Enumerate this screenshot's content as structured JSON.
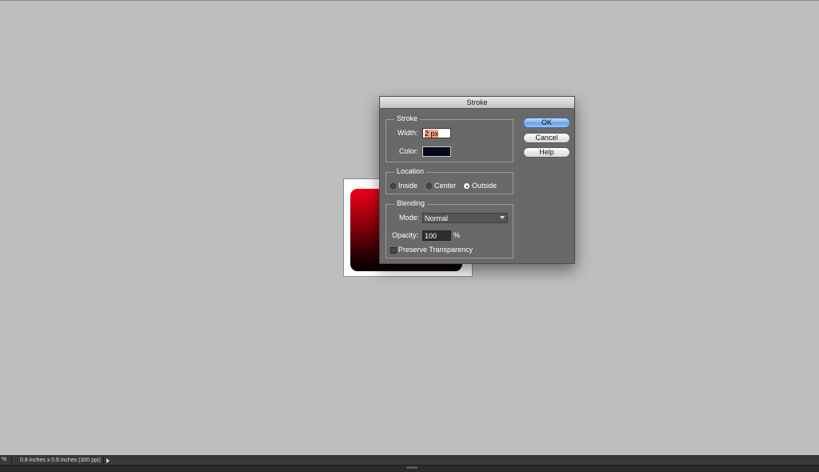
{
  "dialog": {
    "title": "Stroke",
    "stroke_group": {
      "title": "Stroke",
      "width_label": "Width:",
      "width_value": "2 px",
      "color_label": "Color:",
      "color_value": "#070a1f"
    },
    "location_group": {
      "title": "Location",
      "options": [
        "Inside",
        "Center",
        "Outside"
      ],
      "selected": "Outside"
    },
    "blending_group": {
      "title": "Blending",
      "mode_label": "Mode:",
      "mode_value": "Normal",
      "opacity_label": "Opacity:",
      "opacity_value": "100",
      "opacity_unit": "%",
      "preserve_label": "Preserve Transparency",
      "preserve_checked": false
    },
    "buttons": {
      "ok": "OK",
      "cancel": "Cancel",
      "help": "Help"
    }
  },
  "statusbar": {
    "zoom": "%",
    "doc_info": "0.8 inches x 0.6 inches (300 ppi)"
  },
  "colors": {
    "workspace": "#bebebe",
    "dialog_bg": "#696969",
    "ok_accent": "#6aa1e6",
    "gradient_top": "#f0001a",
    "gradient_bottom": "#000000"
  }
}
